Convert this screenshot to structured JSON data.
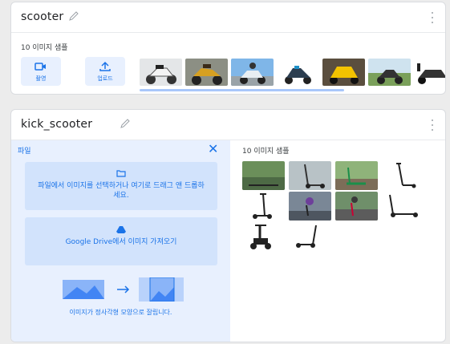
{
  "card1": {
    "title": "scooter",
    "samples_label": "10 이미지 샘플",
    "buttons": {
      "capture_label": "촬영",
      "upload_label": "업로드"
    },
    "thumbnails": [
      "scooter-photo",
      "scooter-photo",
      "scooter-photo",
      "scooter-photo",
      "scooter-photo",
      "scooter-photo",
      "scooter-photo"
    ]
  },
  "card2": {
    "title": "kick_scooter",
    "panel": {
      "title": "파일",
      "close_icon": "close-icon",
      "file_drop_text": "파일에서 이미지를 선택하거나 여기로 드래그 앤 드롭하세요.",
      "drive_text_brand": "Google Drive",
      "drive_text_rest": "에서 이미지 가져오기",
      "crop_note": "이미지가 정사각형 모양으로 잘립니다."
    },
    "samples_label": "10 이미지 샘플",
    "thumbnails": [
      "kick-scooter-photo",
      "kick-scooter-photo",
      "kick-scooter-photo",
      "kick-scooter-photo",
      "kick-scooter-photo",
      "kick-scooter-photo",
      "kick-scooter-photo",
      "kick-scooter-photo",
      "kick-scooter-photo",
      "kick-scooter-photo"
    ]
  },
  "colors": {
    "accent": "#1a73e8",
    "panel_bg": "#e8f0fe",
    "box_bg": "#d2e3fc"
  }
}
